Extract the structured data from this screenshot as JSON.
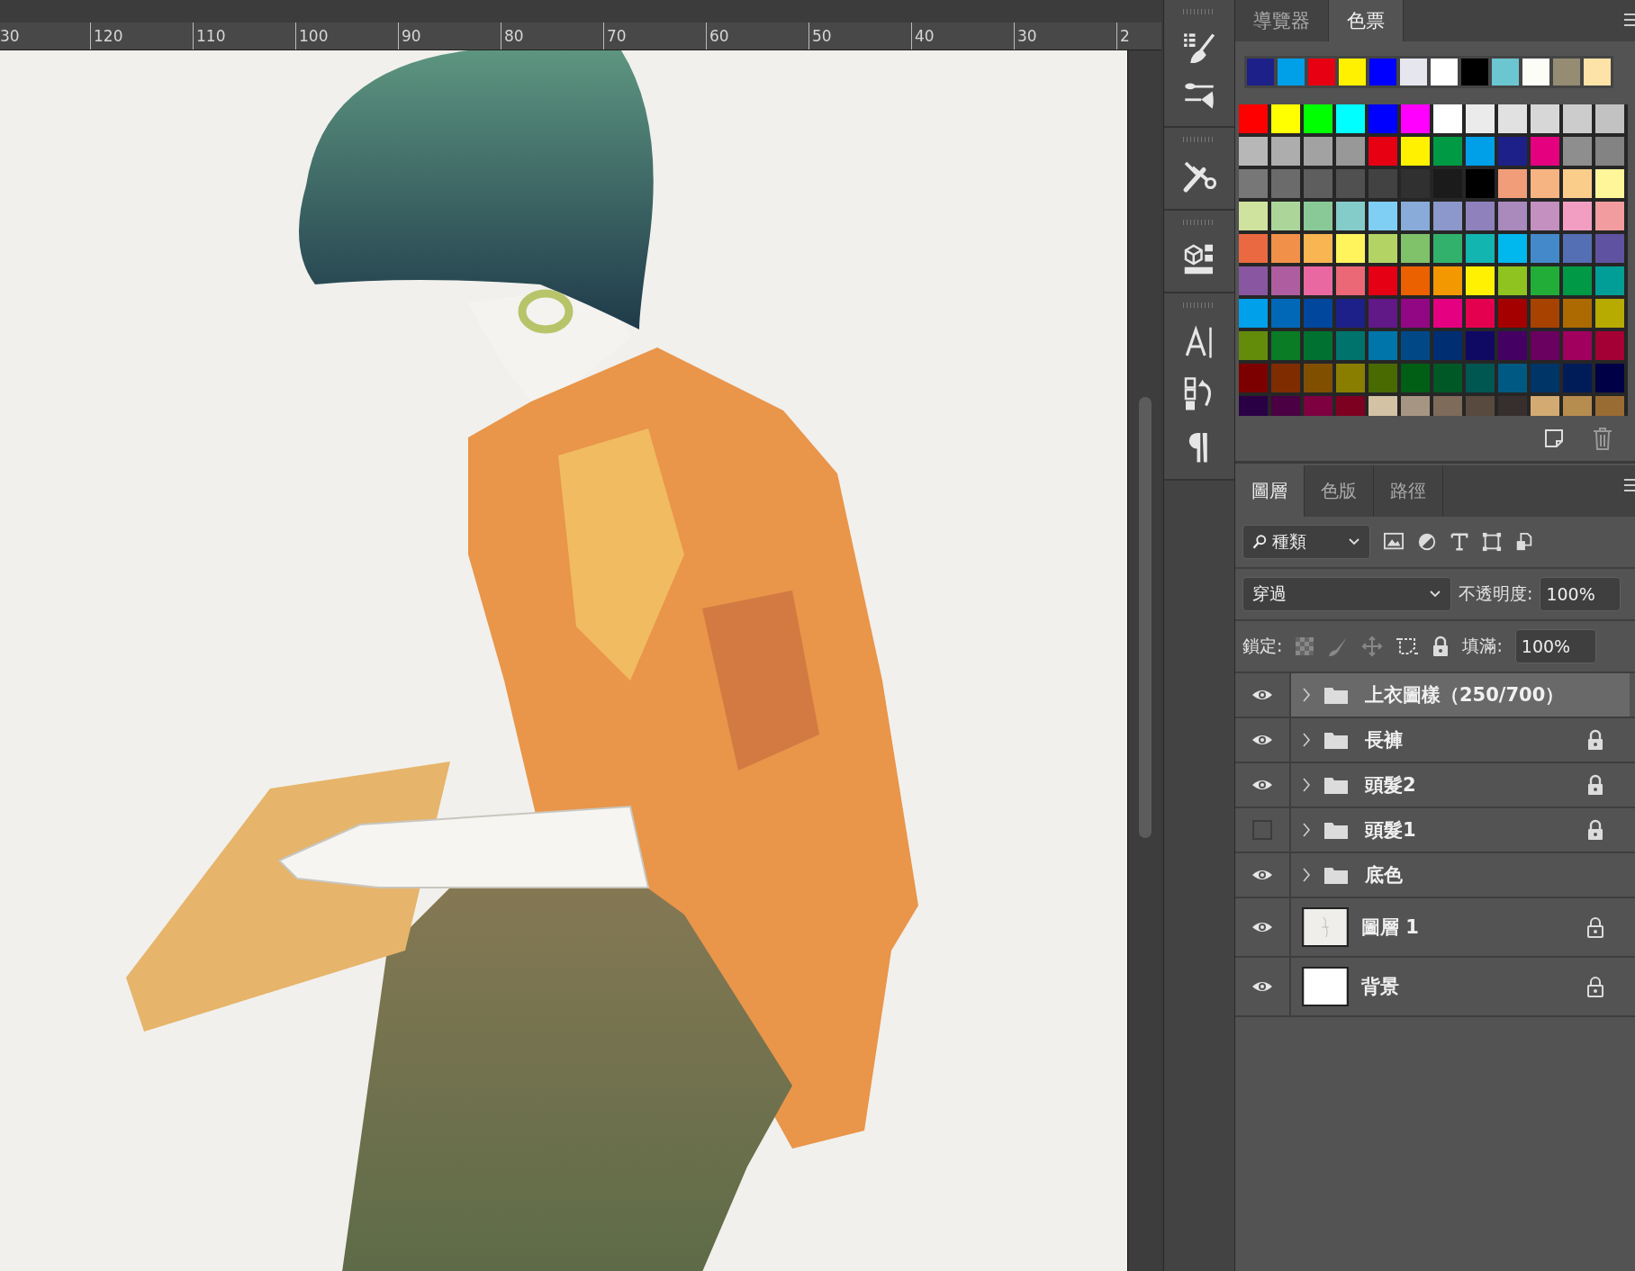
{
  "ruler": {
    "labels": [
      "30",
      "120",
      "110",
      "100",
      "90",
      "80",
      "70",
      "60",
      "50",
      "40",
      "30",
      "2"
    ]
  },
  "swatches_panel": {
    "tabs": [
      {
        "label": "導覽器",
        "selected": false
      },
      {
        "label": "色票",
        "selected": true
      }
    ],
    "recent": [
      {
        "color": "#1d2088"
      },
      {
        "color": "#00a0e9"
      },
      {
        "color": "#e60012"
      },
      {
        "color": "#fff100"
      },
      {
        "color": "#0000ff"
      },
      {
        "color": "#e6e6ee"
      },
      {
        "color": "#ffffff"
      },
      {
        "color": "#000000"
      },
      {
        "color": "#6cc6d2"
      },
      {
        "color": "#fcfdf7"
      },
      {
        "color": "#968c73"
      },
      {
        "color": "#fde3a7"
      }
    ],
    "rows": [
      {
        "swatches": [
          {
            "color": "#ff0000"
          },
          {
            "color": "#ffff00"
          },
          {
            "color": "#00ff00"
          },
          {
            "color": "#00ffff"
          },
          {
            "color": "#0000ff"
          },
          {
            "color": "#ff00ff"
          },
          {
            "color": "#ffffff"
          },
          {
            "color": "#ebebeb"
          },
          {
            "color": "#e1e1e1"
          },
          {
            "color": "#d7d7d7"
          },
          {
            "color": "#cccccc"
          },
          {
            "color": "#c2c2c2"
          }
        ]
      },
      {
        "swatches": [
          {
            "color": "#b7b7b7"
          },
          {
            "color": "#adadad"
          },
          {
            "color": "#a2a2a2"
          },
          {
            "color": "#989898"
          },
          {
            "color": "#e60012"
          },
          {
            "color": "#fff100"
          },
          {
            "color": "#009944"
          },
          {
            "color": "#00a0e9"
          },
          {
            "color": "#1d2088"
          },
          {
            "color": "#e4007f"
          },
          {
            "color": "#8e8e8e"
          },
          {
            "color": "#838383"
          }
        ]
      },
      {
        "swatches": [
          {
            "color": "#777777"
          },
          {
            "color": "#6b6b6b"
          },
          {
            "color": "#5e5e5e"
          },
          {
            "color": "#505050"
          },
          {
            "color": "#424242"
          },
          {
            "color": "#303030"
          },
          {
            "color": "#1b1b1b"
          },
          {
            "color": "#000000"
          },
          {
            "color": "#f19d7a"
          },
          {
            "color": "#f5b482"
          },
          {
            "color": "#facd8b"
          },
          {
            "color": "#fff69a"
          }
        ]
      },
      {
        "swatches": [
          {
            "color": "#cfe39e"
          },
          {
            "color": "#acd699"
          },
          {
            "color": "#89c997"
          },
          {
            "color": "#84ccc9"
          },
          {
            "color": "#7fcef4"
          },
          {
            "color": "#88abda"
          },
          {
            "color": "#8c97cb"
          },
          {
            "color": "#8f82bc"
          },
          {
            "color": "#aa89bd"
          },
          {
            "color": "#c490bf"
          },
          {
            "color": "#f19ec2"
          },
          {
            "color": "#f29c9f"
          }
        ]
      },
      {
        "swatches": [
          {
            "color": "#eb6941"
          },
          {
            "color": "#f19149"
          },
          {
            "color": "#f8b551"
          },
          {
            "color": "#fff45c"
          },
          {
            "color": "#b3d465"
          },
          {
            "color": "#80c269"
          },
          {
            "color": "#32b16c"
          },
          {
            "color": "#13b5b1"
          },
          {
            "color": "#00b7ee"
          },
          {
            "color": "#448aca"
          },
          {
            "color": "#556fb5"
          },
          {
            "color": "#5f52a0"
          }
        ]
      },
      {
        "swatches": [
          {
            "color": "#8957a1"
          },
          {
            "color": "#ae5da1"
          },
          {
            "color": "#ea68a2"
          },
          {
            "color": "#eb6877"
          },
          {
            "color": "#e60013"
          },
          {
            "color": "#eb6100"
          },
          {
            "color": "#f39800"
          },
          {
            "color": "#fff101"
          },
          {
            "color": "#8fc31f"
          },
          {
            "color": "#22ac38"
          },
          {
            "color": "#009945"
          },
          {
            "color": "#009e96"
          }
        ]
      },
      {
        "swatches": [
          {
            "color": "#00a0ea"
          },
          {
            "color": "#0068b7"
          },
          {
            "color": "#00479d"
          },
          {
            "color": "#1d2089"
          },
          {
            "color": "#601986"
          },
          {
            "color": "#920783"
          },
          {
            "color": "#e40080"
          },
          {
            "color": "#e5004f"
          },
          {
            "color": "#a40000"
          },
          {
            "color": "#a84200"
          },
          {
            "color": "#ac6a00"
          },
          {
            "color": "#b7aa00"
          }
        ]
      },
      {
        "swatches": [
          {
            "color": "#638c0b"
          },
          {
            "color": "#097c25"
          },
          {
            "color": "#007130"
          },
          {
            "color": "#00736d"
          },
          {
            "color": "#0075a9"
          },
          {
            "color": "#004986"
          },
          {
            "color": "#002e73"
          },
          {
            "color": "#100964"
          },
          {
            "color": "#440062"
          },
          {
            "color": "#6a005f"
          },
          {
            "color": "#a1005e"
          },
          {
            "color": "#a40035"
          }
        ]
      },
      {
        "swatches": [
          {
            "color": "#7d0000"
          },
          {
            "color": "#7f2d00"
          },
          {
            "color": "#814f00"
          },
          {
            "color": "#897e00"
          },
          {
            "color": "#486a00"
          },
          {
            "color": "#005e15"
          },
          {
            "color": "#005826"
          },
          {
            "color": "#005651"
          },
          {
            "color": "#005982"
          },
          {
            "color": "#003567"
          },
          {
            "color": "#001c58"
          },
          {
            "color": "#000047"
          }
        ]
      },
      {
        "swatches": [
          {
            "color": "#2a0045"
          },
          {
            "color": "#4a0042"
          },
          {
            "color": "#7e0041"
          },
          {
            "color": "#7e0021"
          },
          {
            "color": "#d4c2a5"
          },
          {
            "color": "#a69582"
          },
          {
            "color": "#7e6b5a"
          },
          {
            "color": "#594a40"
          },
          {
            "color": "#362f2d"
          },
          {
            "color": "#d3ab72"
          },
          {
            "color": "#b78c4f"
          },
          {
            "color": "#996c33"
          }
        ]
      }
    ]
  },
  "layers_panel": {
    "tabs": [
      {
        "label": "圖層",
        "selected": true
      },
      {
        "label": "色版",
        "selected": false
      },
      {
        "label": "路徑",
        "selected": false
      }
    ],
    "filter": {
      "value": "種類"
    },
    "blend_mode": {
      "value": "穿過"
    },
    "opacity": {
      "label": "不透明度:",
      "value": "100%"
    },
    "lock": {
      "label": "鎖定:"
    },
    "fill": {
      "label": "填滿:",
      "value": "100%"
    },
    "layers": [
      {
        "name": "上衣圖樣（250/700）",
        "kind": "group",
        "visible": true,
        "locked": false,
        "selected": true
      },
      {
        "name": "長褲",
        "kind": "group",
        "visible": true,
        "locked": true,
        "selected": false
      },
      {
        "name": "頭髮2",
        "kind": "group",
        "visible": true,
        "locked": true,
        "selected": false
      },
      {
        "name": "頭髮1",
        "kind": "group",
        "visible": false,
        "locked": true,
        "selected": false
      },
      {
        "name": "底色",
        "kind": "group",
        "visible": true,
        "locked": false,
        "selected": false
      },
      {
        "name": "圖層 1",
        "kind": "sketch",
        "visible": true,
        "locked": true,
        "selected": false
      },
      {
        "name": "背景",
        "kind": "background",
        "visible": true,
        "locked": true,
        "selected": false
      }
    ]
  }
}
